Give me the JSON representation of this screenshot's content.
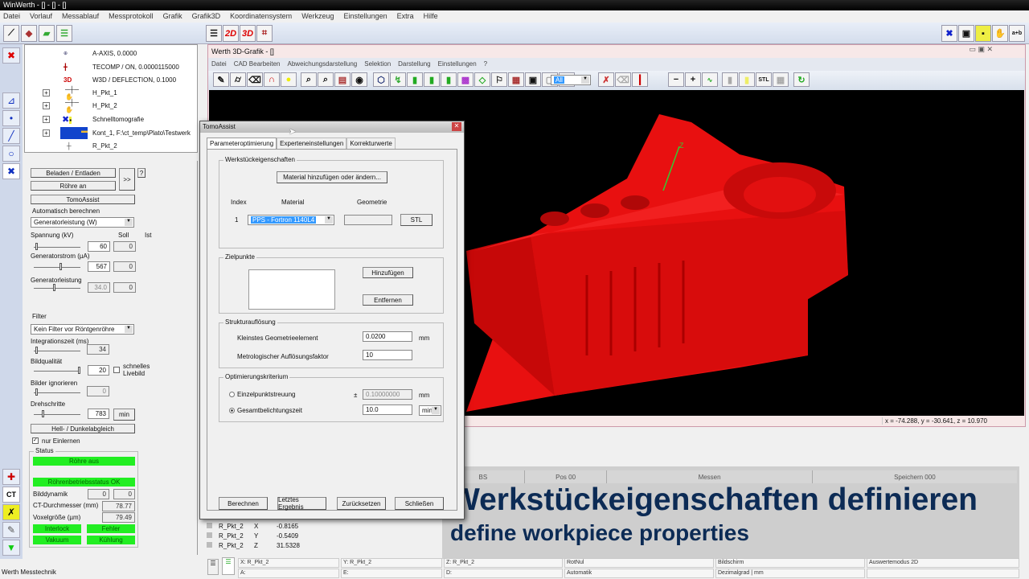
{
  "app": {
    "title": "WinWerth - [] - [] - []",
    "status_left": "Werth Messtechnik"
  },
  "menu": [
    "Datei",
    "Vorlauf",
    "Messablauf",
    "Messprotokoll",
    "Grafik",
    "Grafik3D",
    "Koordinatensystem",
    "Werkzeug",
    "Einstellungen",
    "Extra",
    "Hilfe"
  ],
  "view_tabs": [
    "2D",
    "3D"
  ],
  "tree": [
    {
      "label": "A-AXIS, 0.0000",
      "icon": "offset-icon"
    },
    {
      "label": "TECOMP / ON, 0.0000115000",
      "icon": "thermometer-icon"
    },
    {
      "label": "W3D / DEFLECTION, 0.1000",
      "icon": "3d-icon",
      "icon_text": "3D"
    },
    {
      "label": "H_Pkt_1",
      "icon": "point-icon"
    },
    {
      "label": "H_Pkt_2",
      "icon": "point-icon"
    },
    {
      "label": "Schnelltomografie",
      "icon": "tomography-icon"
    },
    {
      "label": "Kont_1, F:\\ct_temp\\Plato\\Testwerk",
      "icon": "folder-icon"
    },
    {
      "label": "R_Pkt_2",
      "icon": "point-icon"
    }
  ],
  "ct": {
    "load_btn": "Beladen / Entladen",
    "tube_btn": "Röhre an",
    "more_btn": ">>",
    "help_btn": "?",
    "tomo_btn": "TomoAssist",
    "auto_label": "Automatisch berechnen",
    "auto_value": "Generatorleistung (W)",
    "voltage_label": "Spannung (kV)",
    "soll": "Soll",
    "ist": "Ist",
    "voltage_soll": "60",
    "voltage_ist": "0",
    "current_label": "Generatorstrom (µA)",
    "current_soll": "567",
    "current_ist": "0",
    "power_label": "Generatorleistung",
    "power_soll": "34.0",
    "power_ist": "0",
    "filter_label": "Filter",
    "filter_value": "Kein Filter vor Röntgenröhre",
    "integration_label": "Integrationszeit (ms)",
    "integration_value": "34",
    "quality_label": "Bildqualität",
    "quality_value": "20",
    "fast_live": "schnelles Livebild",
    "ignore_label": "Bilder ignorieren",
    "ignore_value": "0",
    "steps_label": "Drehschritte",
    "steps_value": "783",
    "min_btn": "min",
    "calib_btn": "Hell- / Dunkelabgleich",
    "only_teach": "nur Einlernen",
    "status_label": "Status",
    "tube_off": "Röhre aus",
    "tube_ok": "Röhrenbetriebsstatus OK",
    "dynamics_label": "Bilddynamik",
    "dynamics_a": "0",
    "dynamics_b": "0",
    "diameter_label": "CT-Durchmesser (mm)",
    "diameter_value": "78.77",
    "voxel_label": "Voxelgröße (µm)",
    "voxel_value": "79.49",
    "interlock": "Interlock",
    "error": "Fehler",
    "vacuum": "Vakuum",
    "cooling": "Kühlung"
  },
  "sidebar_ct_label": "CT",
  "g3d": {
    "title": "Werth 3D-Grafik - []",
    "menu": [
      "Datei",
      "CAD Bearbeiten",
      "Abweichungsdarstellung",
      "Selektion",
      "Darstellung",
      "Einstellungen",
      "?"
    ],
    "filter_value": "All",
    "stl_btn": "STL",
    "coords": "x = -74.288, y = -30.641, z = 10.970",
    "axis_z": "Z"
  },
  "dialog": {
    "title": "TomoAssist",
    "tabs": [
      "Parameteroptimierung",
      "Experteneinstellungen",
      "Korrekturwerte"
    ],
    "wp_group": "Werkstückeigenschaften",
    "material_btn": "Material hinzufügen oder ändern...",
    "col_index": "Index",
    "col_material": "Material",
    "col_geometry": "Geometrie",
    "row_index": "1",
    "row_material": "PPS - Fortron 1140L4",
    "stl_btn": "STL",
    "target_group": "Zielpunkte",
    "add_btn": "Hinzufügen",
    "remove_btn": "Entfernen",
    "struct_group": "Strukturauflösung",
    "smallest_label": "Kleinstes Geometrieelement",
    "smallest_value": "0.0200",
    "mm": "mm",
    "factor_label": "Metrologischer Auflösungsfaktor",
    "factor_value": "10",
    "opt_group": "Optimierungskriterium",
    "opt1": "Einzelpunktstreuung",
    "pm": "±",
    "opt1_value": "0.10000000",
    "opt2": "Gesamtbelichtungszeit",
    "opt2_value": "10.0",
    "unit": "min",
    "calc_btn": "Berechnen",
    "last_btn": "Letztes Ergebnis",
    "reset_btn": "Zurücksetzen",
    "close_btn": "Schließen"
  },
  "bar": [
    "BS",
    "Pos 00",
    "Messen",
    "Speichern 000"
  ],
  "results": [
    {
      "name": "R_Pkt_2",
      "axis": "X",
      "value": "-0.8165"
    },
    {
      "name": "R_Pkt_2",
      "axis": "Y",
      "value": "-0.5409"
    },
    {
      "name": "R_Pkt_2",
      "axis": "Z",
      "value": "31.5328"
    }
  ],
  "statusbar": {
    "row1": [
      "X: R_Pkt_2",
      "Y: R_Pkt_2",
      "Z: R_Pkt_2",
      "RotNul",
      "Bildschirm",
      "Auswertemodus 2D"
    ],
    "row2": [
      "A:",
      "E:",
      "D:",
      "Automatik",
      "Dezimalgrad | mm",
      ""
    ]
  },
  "caption": {
    "de": "Werkstückeigenschaften definieren",
    "en": "define workpiece properties"
  },
  "colors": {
    "part": "#ee1111",
    "status_green": "#22ee22",
    "caption": "#0c2b55"
  }
}
